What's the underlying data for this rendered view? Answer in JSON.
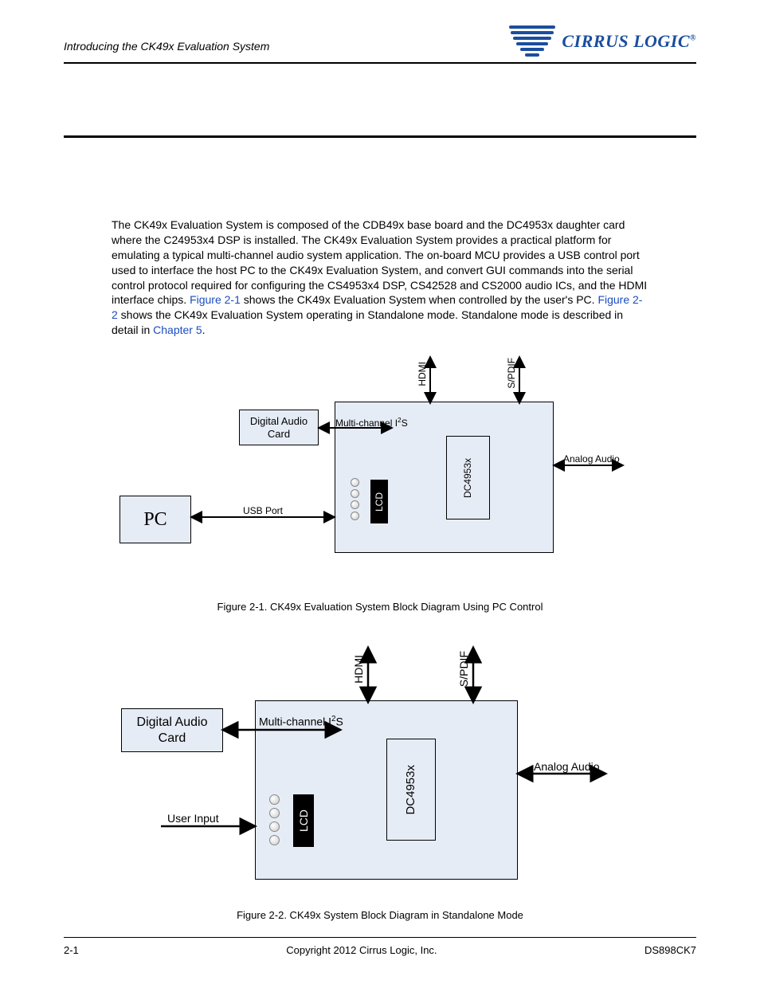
{
  "header": {
    "section_title": "Introducing the CK49x Evaluation System",
    "brand": "CIRRUS LOGIC",
    "reg": "®"
  },
  "paragraph": {
    "p1a": "The CK49x Evaluation System is composed of the CDB49x base board and the DC4953x daughter card where the C24953x4 DSP is installed. The CK49x Evaluation System provides a practical platform for emulating a typical multi-channel audio system application. The on-board MCU provides a USB control port used to interface the host PC to the CK49x Evaluation System, and convert GUI commands into the serial control protocol required for configuring the CS4953x4 DSP, CS42528 and CS2000 audio ICs, and the HDMI interface chips. ",
    "link1": "Figure 2-1",
    "p1b": " shows the CK49x Evaluation System when controlled by the user's PC. ",
    "link2": "Figure 2-2",
    "p1c": " shows the CK49x Evaluation System operating in Standalone mode. Standalone mode is described in detail in ",
    "link3": "Chapter 5",
    "p1d": "."
  },
  "fig1": {
    "caption": "Figure 2-1. CK49x Evaluation System Block Diagram Using PC Control",
    "pc": "PC",
    "digital_audio_card": "Digital Audio\nCard",
    "usb_port": "USB Port",
    "multi_i2s": "Multi-channel  I",
    "i2s_sup": "2",
    "i2s_suffix": "S",
    "hdmi": "HDMI",
    "spdif": "S/PDIF",
    "dc4953x": "DC4953x",
    "lcd": "LCD",
    "analog_audio": "Analog Audio"
  },
  "fig2": {
    "caption": "Figure 2-2. CK49x System Block Diagram in Standalone Mode",
    "digital_audio_card": "Digital Audio\nCard",
    "user_input": "User Input",
    "multi_i2s": "Multi-channel  I",
    "i2s_sup": "2",
    "i2s_suffix": "S",
    "hdmi": "HDMI",
    "spdif": "S/PDIF",
    "dc4953x": "DC4953x",
    "lcd": "LCD",
    "analog_audio": "Analog Audio"
  },
  "footer": {
    "left": "2-1",
    "center": "Copyright 2012 Cirrus Logic, Inc.",
    "right": "DS898CK7"
  }
}
